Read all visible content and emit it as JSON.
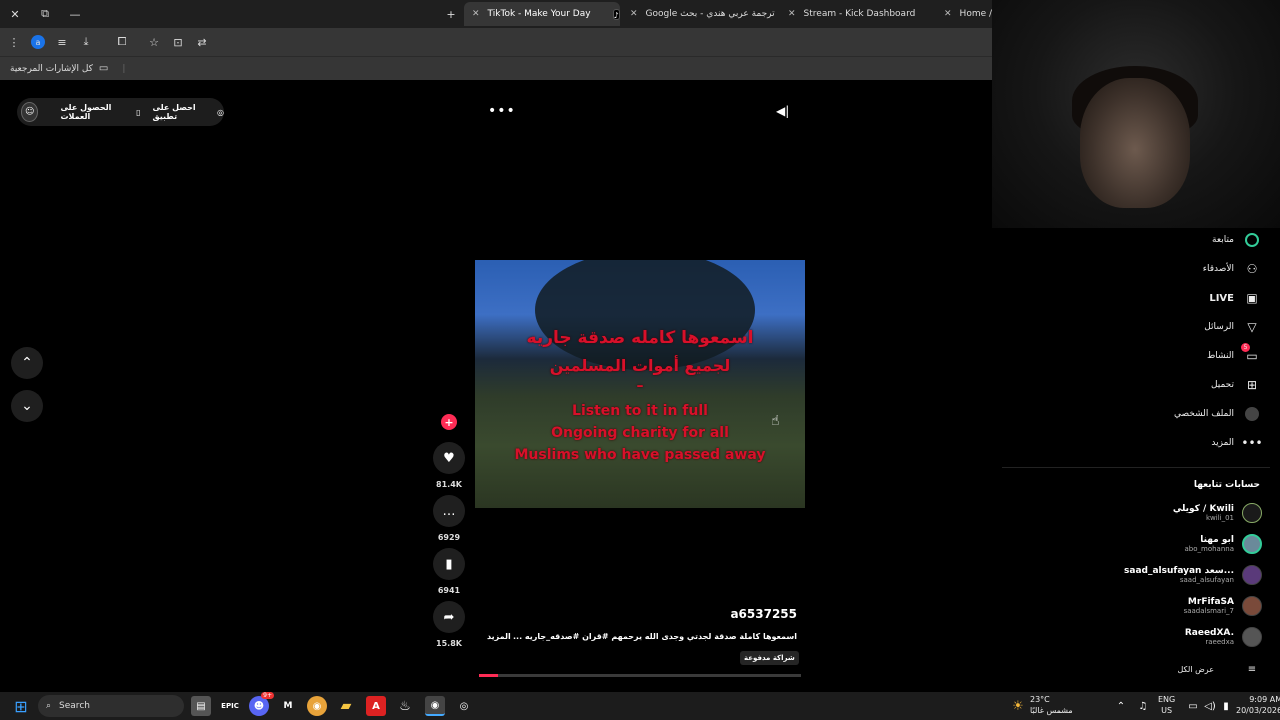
{
  "browser": {
    "window_controls": [
      "✕",
      "⧉",
      "—"
    ],
    "new_tab": "+",
    "tabs": [
      {
        "title": "TikTok - Make Your Day",
        "favicon": "tiktok-icon",
        "active": true
      },
      {
        "title": "ترجمة عربي هندي - بحث Google",
        "favicon": "google-icon",
        "active": false
      },
      {
        "title": "Stream - Kick Dashboard",
        "favicon": "kick-icon",
        "active": false
      },
      {
        "title": "Home / X",
        "favicon": "x-icon",
        "active": false
      }
    ],
    "profile_letter": "a",
    "bookmarks_label": "كل الإشارات المرجعية"
  },
  "tiktok": {
    "get_app": "احصل على تطبيق",
    "get_coins": "الحصول على العملات",
    "video_text": [
      "اسمعوها كامله صدقة جاريه",
      "لجميع أموات المسلمين",
      "–",
      "Listen to it in full",
      "Ongoing charity for all",
      "Muslims who have passed away"
    ],
    "likes": "81.4K",
    "comments": "6929",
    "saves": "6941",
    "shares": "15.8K",
    "author": "a6537255",
    "caption": "اسمعوها كاملة صدقة لجدتي وجدى الله يرحمهم #قران #صدقه_جاريه ...",
    "more": "المزيد",
    "paid": "شراكة مدفوعة",
    "progress": 0.06
  },
  "sidebar": {
    "items": [
      {
        "label": "متابعة",
        "icon": "following-icon"
      },
      {
        "label": "الأصدقاء",
        "icon": "friends-icon"
      },
      {
        "label": "LIVE",
        "icon": "live-icon"
      },
      {
        "label": "الرسائل",
        "icon": "messages-icon"
      },
      {
        "label": "النشاط",
        "icon": "activity-icon",
        "badge": "5"
      },
      {
        "label": "تحميل",
        "icon": "upload-icon"
      },
      {
        "label": "الملف الشخصي",
        "icon": "profile-icon"
      },
      {
        "label": "المزيد",
        "icon": "more-icon"
      }
    ],
    "following_title": "حسابات تتابعها",
    "accounts": [
      {
        "name": "كويلي / Kwili",
        "handle": "kwili_01"
      },
      {
        "name": "ابو مهنا",
        "handle": "abo_mohanna"
      },
      {
        "name": "saad_alsufayan سعد...",
        "handle": "saad_alsufayan"
      },
      {
        "name": "MrFifaSA",
        "handle": "saadalsmari_7"
      },
      {
        "name": "RaeedXA.",
        "handle": "raeedxa"
      }
    ],
    "see_all": "عرض الكل"
  },
  "taskbar": {
    "search": "Search",
    "weather_temp": "23°C",
    "weather_desc": "مشمس غالبًا",
    "lang": "ENG",
    "region": "US",
    "time": "9:09 AM",
    "date": "20/03/2026",
    "discord_badge": "9+"
  },
  "colors": {
    "accent": "#fe2c55",
    "video_text": "#d8102a"
  }
}
